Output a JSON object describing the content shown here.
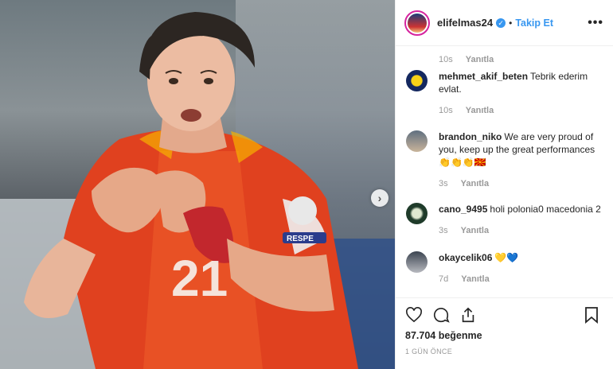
{
  "post": {
    "username": "elifelmas24",
    "verified_badge": "✓",
    "separator": "•",
    "follow_label": "Takip Et",
    "more_label": "•••",
    "next_label": "›"
  },
  "comments": {
    "top_meta": {
      "time": "10s",
      "reply": "Yanıtla"
    },
    "items": [
      {
        "username": "mehmet_akif_beten",
        "text": "Tebrik ederim evlat.",
        "time": "10s",
        "reply": "Yanıtla"
      },
      {
        "username": "brandon_niko",
        "text": "We are very proud of you, keep up the great performances 👏👏👏🇲🇰",
        "time": "3s",
        "reply": "Yanıtla"
      },
      {
        "username": "cano_9495",
        "text": "holi polonia0 macedonia 2",
        "time": "3s",
        "reply": "Yanıtla"
      },
      {
        "username": "okaycelik06",
        "text": "💛💙",
        "time": "7d",
        "reply": "Yanıtla"
      }
    ]
  },
  "actions": {
    "icons": [
      "heart-icon",
      "comment-icon",
      "share-icon",
      "bookmark-icon"
    ],
    "likes": "87.704 beğenme",
    "timeago": "1 GÜN ÖNCE"
  },
  "colors": {
    "accent": "#3897f0",
    "jersey": "#e0411f",
    "text": "#262626",
    "muted": "#999999"
  }
}
